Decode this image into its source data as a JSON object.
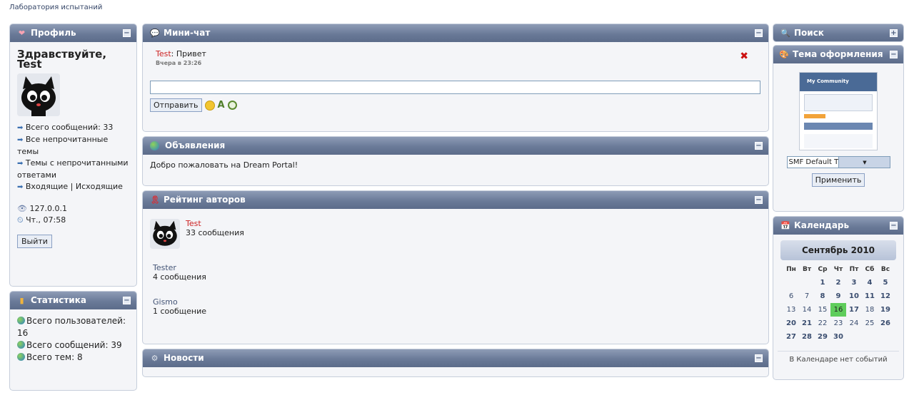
{
  "breadcrumb": "Лаборатория испытаний",
  "profile": {
    "title": "Профиль",
    "greeting": "Здравствуйте, Test",
    "links": [
      "Всего сообщений: 33",
      "Все непрочитанные темы",
      "Темы с непрочитанными ответами",
      "Входящие | Исходящие"
    ],
    "ip": "127.0.0.1",
    "time": "Чт., 07:58",
    "logout": "Выйти"
  },
  "stats": {
    "title": "Статистика",
    "lines": [
      "Всего пользователей: 16",
      "Всего сообщений: 39",
      "Всего тем: 8"
    ]
  },
  "chat": {
    "title": "Мини-чат",
    "message_user": "Test",
    "message_text": ": Привет",
    "message_time": "Вчера в 23:26",
    "send": "Отправить"
  },
  "announcements": {
    "title": "Объявления",
    "text": "Добро пожаловать на Dream Portal!"
  },
  "rating": {
    "title": "Рейтинг авторов",
    "authors": [
      {
        "name": "Test",
        "count": "33 сообщения"
      },
      {
        "name": "Tester",
        "count": "4 сообщения"
      },
      {
        "name": "Gismo",
        "count": "1 сообщение"
      }
    ]
  },
  "news": {
    "title": "Новости"
  },
  "search": {
    "title": "Поиск"
  },
  "theme": {
    "title": "Тема оформления",
    "thumb_text": "My Community",
    "selected": "SMF Default Theme ...",
    "apply": "Применить"
  },
  "calendar": {
    "title": "Календарь",
    "month": "Сентябрь 2010",
    "weekdays": [
      "Пн",
      "Вт",
      "Ср",
      "Чт",
      "Пт",
      "Сб",
      "Вс"
    ],
    "weeks": [
      [
        "",
        "",
        "1",
        "2",
        "3",
        "4",
        "5"
      ],
      [
        "6",
        "7",
        "8",
        "9",
        "10",
        "11",
        "12"
      ],
      [
        "13",
        "14",
        "15",
        "16",
        "17",
        "18",
        "19"
      ],
      [
        "20",
        "21",
        "22",
        "23",
        "24",
        "25",
        "26"
      ],
      [
        "27",
        "28",
        "29",
        "30",
        "",
        "",
        ""
      ]
    ],
    "today": "16",
    "note": "В Календаре нет событий"
  },
  "colors": {
    "header": "#6a7a98",
    "accent_red": "#cc2222",
    "today_green": "#5fcd5b"
  }
}
